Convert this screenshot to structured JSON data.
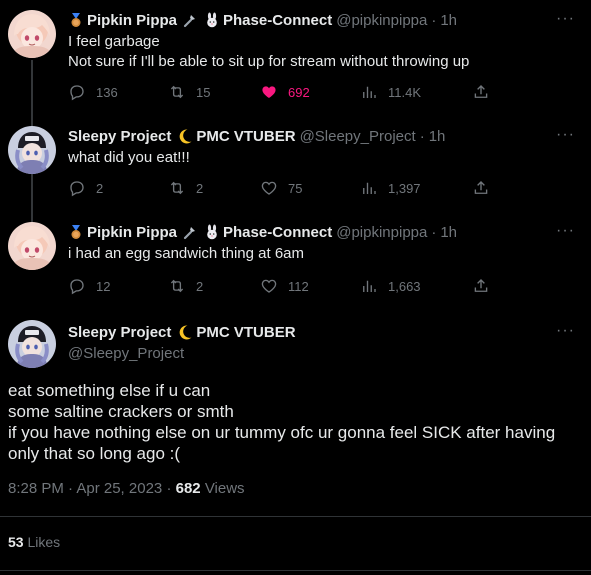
{
  "tweets": [
    {
      "name": "Pipkin Pippa",
      "group": "Phase-Connect",
      "handle": "@pipkinpippa",
      "time": "1h",
      "text": "I feel garbage\nNot sure if I'll be able to sit up for stream without throwing up",
      "replies": "136",
      "retweets": "15",
      "likes": "692",
      "views": "11.4K",
      "liked": true
    },
    {
      "name": "Sleepy Project",
      "group": "PMC VTUBER",
      "handle": "@Sleepy_Project",
      "time": "1h",
      "text": "what did you eat!!!",
      "replies": "2",
      "retweets": "2",
      "likes": "75",
      "views": "1,397",
      "liked": false
    },
    {
      "name": "Pipkin Pippa",
      "group": "Phase-Connect",
      "handle": "@pipkinpippa",
      "time": "1h",
      "text": "i had an egg sandwich thing at 6am",
      "replies": "12",
      "retweets": "2",
      "likes": "112",
      "views": "1,663",
      "liked": false
    }
  ],
  "focused": {
    "name": "Sleepy Project",
    "group": "PMC VTUBER",
    "handle": "@Sleepy_Project",
    "text": "eat something else if u can\nsome saltine crackers or smth\nif you have nothing else on ur tummy ofc ur gonna feel SICK after having only that so long ago :(",
    "timestamp": "8:28 PM · Apr 25, 2023",
    "separator": "·",
    "views_count": "682",
    "views_label": "Views",
    "likes_count": "53",
    "likes_label": "Likes"
  },
  "dot": "·",
  "more": "···",
  "colors": {
    "like_active": "#f91880",
    "muted": "#71767b",
    "text": "#e7e9ea",
    "background": "#000000"
  },
  "icons": [
    "reply-icon",
    "retweet-icon",
    "heart-icon",
    "views-icon",
    "share-icon",
    "more-icon",
    "medal-emoji",
    "wrench-emoji",
    "rabbit-emoji",
    "moon-emoji"
  ]
}
